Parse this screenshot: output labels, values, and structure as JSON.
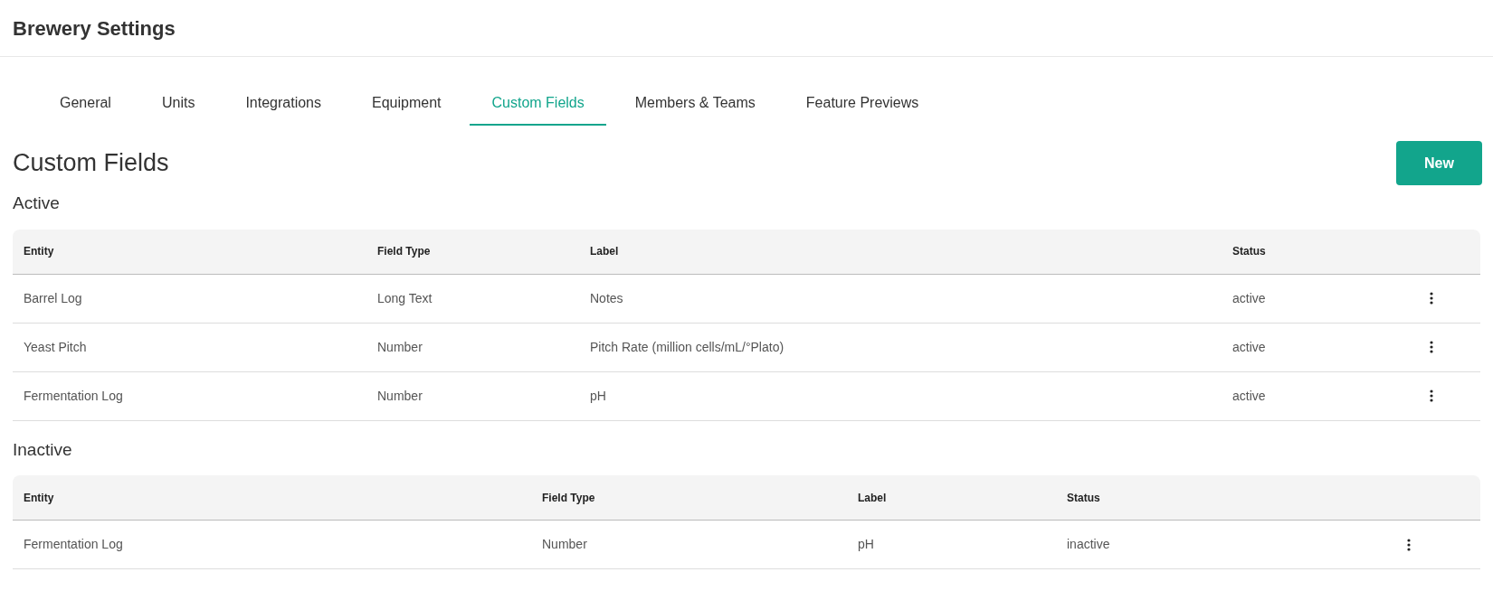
{
  "header": {
    "title": "Brewery Settings"
  },
  "tabs": [
    {
      "label": "General",
      "selected": false
    },
    {
      "label": "Units",
      "selected": false
    },
    {
      "label": "Integrations",
      "selected": false
    },
    {
      "label": "Equipment",
      "selected": false
    },
    {
      "label": "Custom Fields",
      "selected": true
    },
    {
      "label": "Members & Teams",
      "selected": false
    },
    {
      "label": "Feature Previews",
      "selected": false
    }
  ],
  "page": {
    "title": "Custom Fields",
    "new_button": "New"
  },
  "sections": [
    {
      "title": "Active",
      "columns": [
        "Entity",
        "Field Type",
        "Label",
        "Status"
      ],
      "rows": [
        [
          "Barrel Log",
          "Long Text",
          "Notes",
          "active"
        ],
        [
          "Yeast Pitch",
          "Number",
          "Pitch Rate (million cells/mL/°Plato)",
          "active"
        ],
        [
          "Fermentation Log",
          "Number",
          "pH",
          "active"
        ]
      ]
    },
    {
      "title": "Inactive",
      "columns": [
        "Entity",
        "Field Type",
        "Label",
        "Status"
      ],
      "rows": [
        [
          "Fermentation Log",
          "Number",
          "pH",
          "inactive"
        ]
      ]
    }
  ]
}
